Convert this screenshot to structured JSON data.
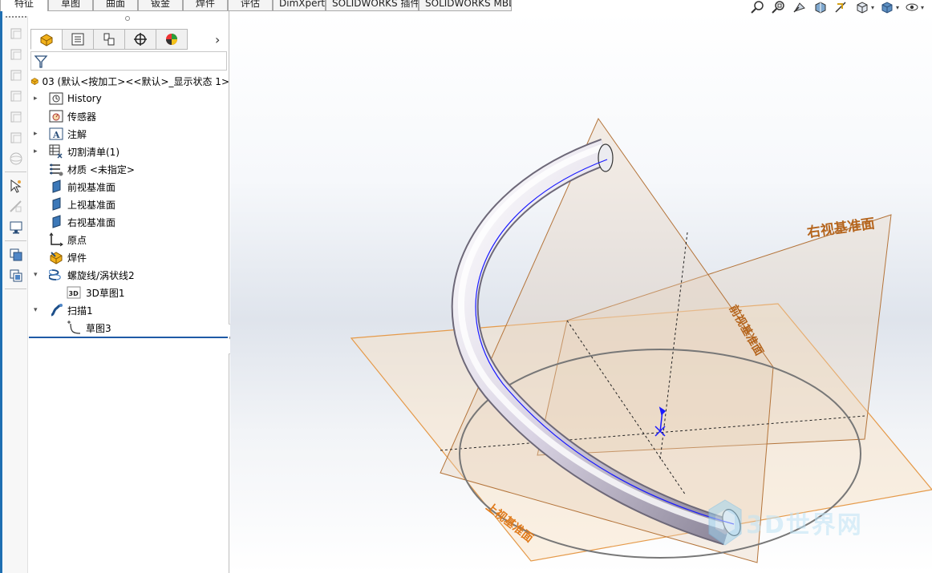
{
  "command_tabs": [
    "特征",
    "草图",
    "曲面",
    "钣金",
    "焊件",
    "评估",
    "DimXpert",
    "SOLIDWORKS 插件",
    "SOLIDWORKS MBD"
  ],
  "feature_tree": {
    "root_label": "03  (默认<按加工><<默认>_显示状态 1>",
    "items": [
      {
        "label": "History",
        "icon": "history-icon",
        "expand": "collapsed"
      },
      {
        "label": "传感器",
        "icon": "sensor-icon",
        "expand": "none"
      },
      {
        "label": "注解",
        "icon": "annotation-icon",
        "expand": "collapsed"
      },
      {
        "label": "切割清单(1)",
        "icon": "cut-list-icon",
        "expand": "collapsed"
      },
      {
        "label": "材质 <未指定>",
        "icon": "material-icon",
        "expand": "none"
      },
      {
        "label": "前视基准面",
        "icon": "plane-icon",
        "expand": "none"
      },
      {
        "label": "上视基准面",
        "icon": "plane-icon",
        "expand": "none"
      },
      {
        "label": "右视基准面",
        "icon": "plane-icon",
        "expand": "none"
      },
      {
        "label": "原点",
        "icon": "origin-icon",
        "expand": "none"
      },
      {
        "label": "焊件",
        "icon": "weldment-icon",
        "expand": "none"
      },
      {
        "label": "螺旋线/涡状线2",
        "icon": "helix-icon",
        "expand": "expanded"
      },
      {
        "label": "3D草图1",
        "icon": "sketch3d-icon",
        "expand": "child"
      },
      {
        "label": "扫描1",
        "icon": "sweep-icon",
        "expand": "expanded"
      },
      {
        "label": "草图3",
        "icon": "sketch-icon",
        "expand": "child"
      }
    ]
  },
  "viewport": {
    "plane_right_label": "右视基准面",
    "plane_front_label": "前视基准面",
    "plane_top_label": "上视基准面",
    "watermark": "3D世界网",
    "colors": {
      "plane_edge": "#d9822b",
      "plane_fill": "#f5d6b0",
      "path": "#1a1aff",
      "label": "#b5651d"
    }
  }
}
